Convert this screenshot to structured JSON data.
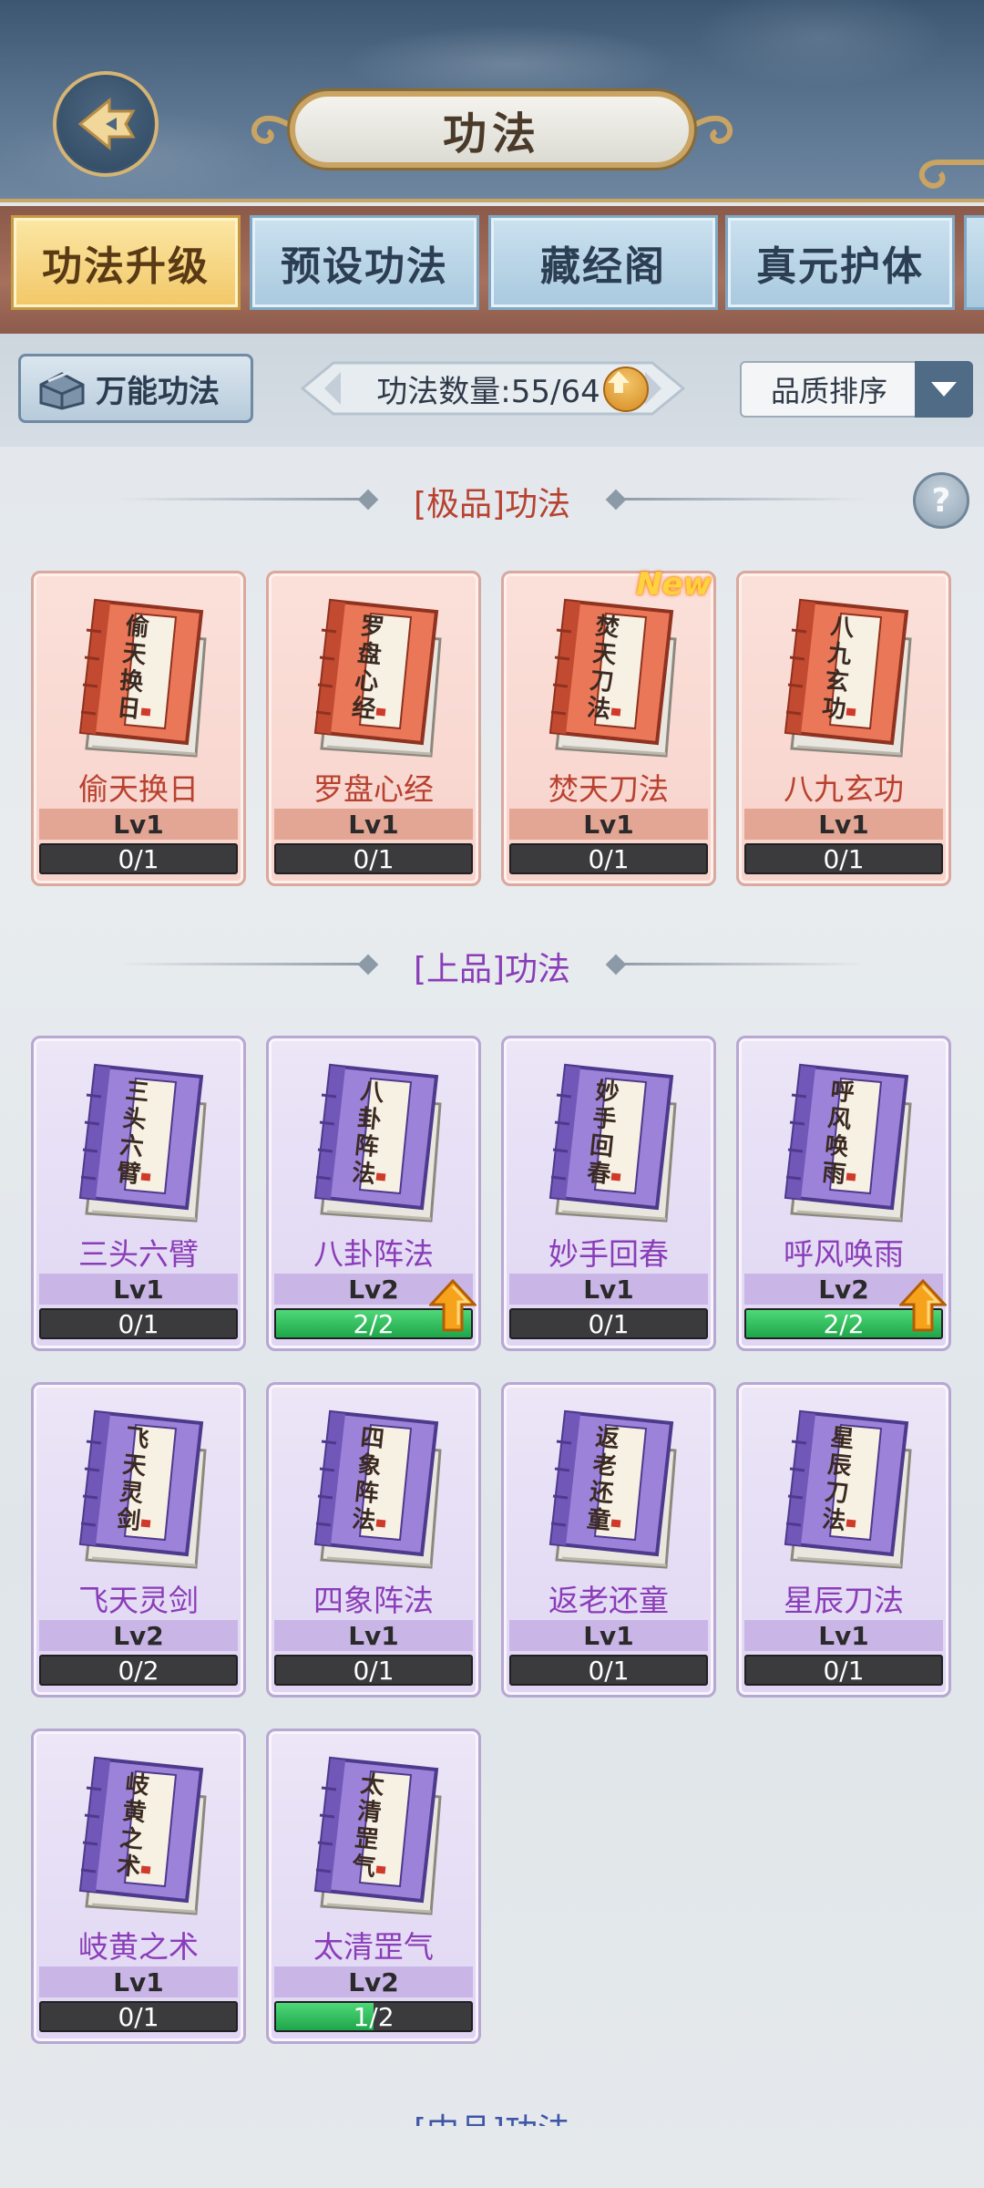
{
  "header": {
    "title": "功法"
  },
  "tabs": [
    {
      "label": "功法升级",
      "active": true
    },
    {
      "label": "预设功法",
      "active": false
    },
    {
      "label": "藏经阁",
      "active": false
    },
    {
      "label": "真元护体",
      "active": false
    }
  ],
  "toolbar": {
    "universal_label": "万能功法",
    "count_label": "功法数量:55/64",
    "sort_label": "品质排序"
  },
  "sections": [
    {
      "title": "[极品]功法",
      "color": "#b8412f",
      "tier": "top",
      "cards": [
        {
          "spine": "偷天换日",
          "name": "偷天换日",
          "level": "Lv1",
          "progress": "0/1",
          "fraction": 0,
          "is_new": false,
          "can_upgrade": false
        },
        {
          "spine": "罗盘心经",
          "name": "罗盘心经",
          "level": "Lv1",
          "progress": "0/1",
          "fraction": 0,
          "is_new": false,
          "can_upgrade": false
        },
        {
          "spine": "焚天刀法",
          "name": "焚天刀法",
          "level": "Lv1",
          "progress": "0/1",
          "fraction": 0,
          "is_new": true,
          "new_label": "New",
          "can_upgrade": false
        },
        {
          "spine": "八九玄功",
          "name": "八九玄功",
          "level": "Lv1",
          "progress": "0/1",
          "fraction": 0,
          "is_new": false,
          "can_upgrade": false
        }
      ]
    },
    {
      "title": "[上品]功法",
      "color": "#8a3db8",
      "tier": "high",
      "cards": [
        {
          "spine": "三头六臂",
          "name": "三头六臂",
          "level": "Lv1",
          "progress": "0/1",
          "fraction": 0,
          "is_new": false,
          "can_upgrade": false
        },
        {
          "spine": "八卦阵法",
          "name": "八卦阵法",
          "level": "Lv2",
          "progress": "2/2",
          "fraction": 1,
          "is_new": false,
          "can_upgrade": true
        },
        {
          "spine": "妙手回春",
          "name": "妙手回春",
          "level": "Lv1",
          "progress": "0/1",
          "fraction": 0,
          "is_new": false,
          "can_upgrade": false
        },
        {
          "spine": "呼风唤雨",
          "name": "呼风唤雨",
          "level": "Lv2",
          "progress": "2/2",
          "fraction": 1,
          "is_new": false,
          "can_upgrade": true
        },
        {
          "spine": "飞天灵剑",
          "name": "飞天灵剑",
          "level": "Lv2",
          "progress": "0/2",
          "fraction": 0,
          "is_new": false,
          "can_upgrade": false
        },
        {
          "spine": "四象阵法",
          "name": "四象阵法",
          "level": "Lv1",
          "progress": "0/1",
          "fraction": 0,
          "is_new": false,
          "can_upgrade": false
        },
        {
          "spine": "返老还童",
          "name": "返老还童",
          "level": "Lv1",
          "progress": "0/1",
          "fraction": 0,
          "is_new": false,
          "can_upgrade": false
        },
        {
          "spine": "星辰刀法",
          "name": "星辰刀法",
          "level": "Lv1",
          "progress": "0/1",
          "fraction": 0,
          "is_new": false,
          "can_upgrade": false
        },
        {
          "spine": "岐黄之术",
          "name": "岐黄之术",
          "level": "Lv1",
          "progress": "0/1",
          "fraction": 0,
          "is_new": false,
          "can_upgrade": false
        },
        {
          "spine": "太清罡气",
          "name": "太清罡气",
          "level": "Lv2",
          "progress": "1/2",
          "fraction": 0.5,
          "is_new": false,
          "can_upgrade": false
        }
      ]
    }
  ],
  "next_section": {
    "title": "[中品]功法",
    "color": "#3f57a6"
  },
  "icons": {
    "back": "back-arrow-icon",
    "chest": "chest-icon",
    "count_up": "upgrade-arrow-icon",
    "sort": "chevron-down-icon",
    "help": "help-icon",
    "help_glyph": "?"
  },
  "colors": {
    "top_tier": "#b8412f",
    "high_tier": "#8a3db8",
    "progress_fill": "#1ea64a",
    "active_tab": "#f2c767"
  }
}
